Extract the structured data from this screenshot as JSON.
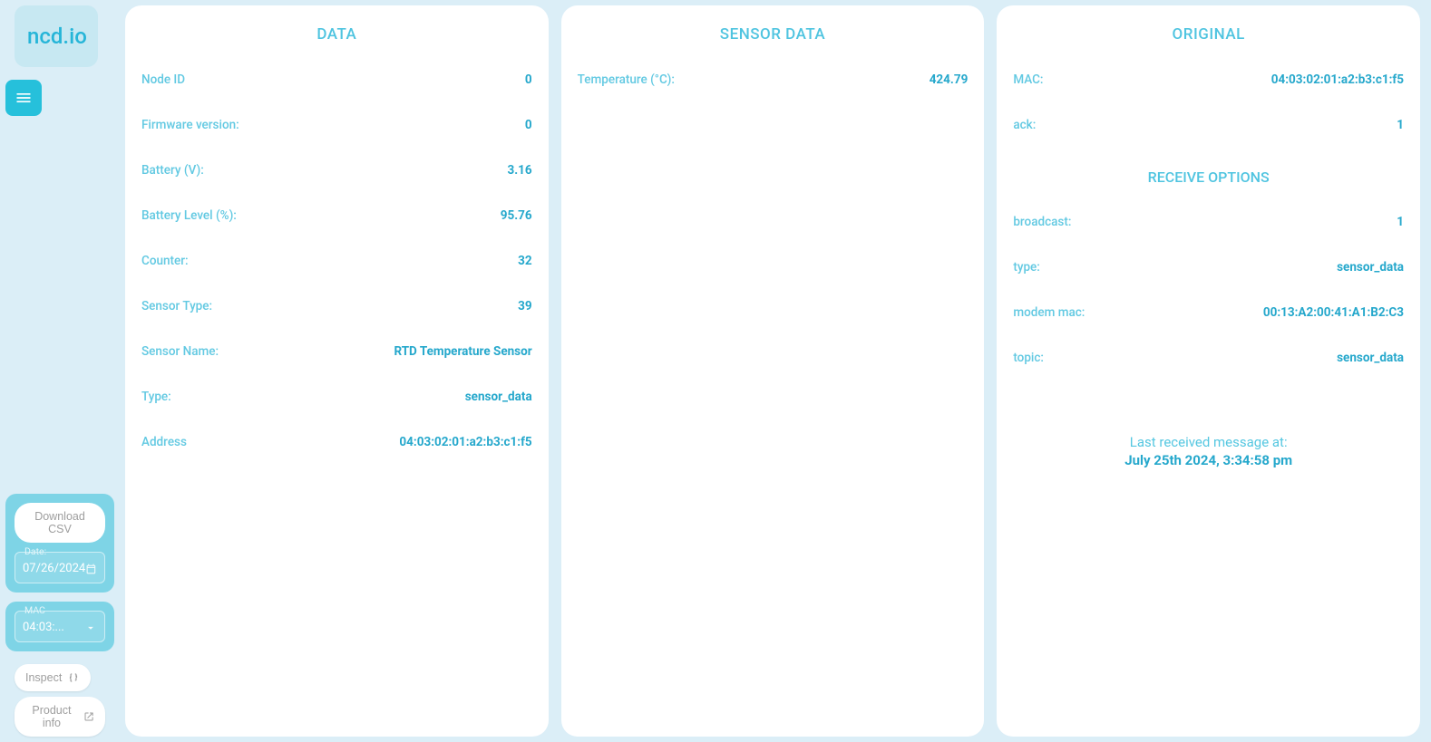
{
  "brand": "ncd.io",
  "sidebar": {
    "download_csv": "Download CSV",
    "date_label": "Date:",
    "date_value": "07/26/2024",
    "mac_label": "MAC",
    "mac_value": "04:03:...",
    "inspect": "Inspect",
    "product_info": "Product info"
  },
  "panels": {
    "data": {
      "title": "DATA",
      "rows": [
        {
          "label": "Node ID",
          "value": "0"
        },
        {
          "label": "Firmware version:",
          "value": "0"
        },
        {
          "label": "Battery (V):",
          "value": "3.16"
        },
        {
          "label": "Battery Level (%):",
          "value": "95.76"
        },
        {
          "label": "Counter:",
          "value": "32"
        },
        {
          "label": "Sensor Type:",
          "value": "39"
        },
        {
          "label": "Sensor Name:",
          "value": "RTD Temperature Sensor"
        },
        {
          "label": "Type:",
          "value": "sensor_data"
        },
        {
          "label": "Address",
          "value": "04:03:02:01:a2:b3:c1:f5"
        }
      ]
    },
    "sensor_data": {
      "title": "SENSOR DATA",
      "rows": [
        {
          "label": "Temperature (°C):",
          "value": "424.79"
        }
      ]
    },
    "original": {
      "title": "ORIGINAL",
      "rows": [
        {
          "label": "MAC:",
          "value": "04:03:02:01:a2:b3:c1:f5"
        },
        {
          "label": "ack:",
          "value": "1"
        }
      ],
      "receive_title": "RECEIVE OPTIONS",
      "receive_rows": [
        {
          "label": "broadcast:",
          "value": "1"
        },
        {
          "label": "type:",
          "value": "sensor_data"
        },
        {
          "label": "modem mac:",
          "value": "00:13:A2:00:41:A1:B2:C3"
        },
        {
          "label": "topic:",
          "value": "sensor_data"
        }
      ],
      "last_msg_label": "Last received message at:",
      "last_msg_value": "July 25th 2024, 3:34:58 pm"
    }
  }
}
